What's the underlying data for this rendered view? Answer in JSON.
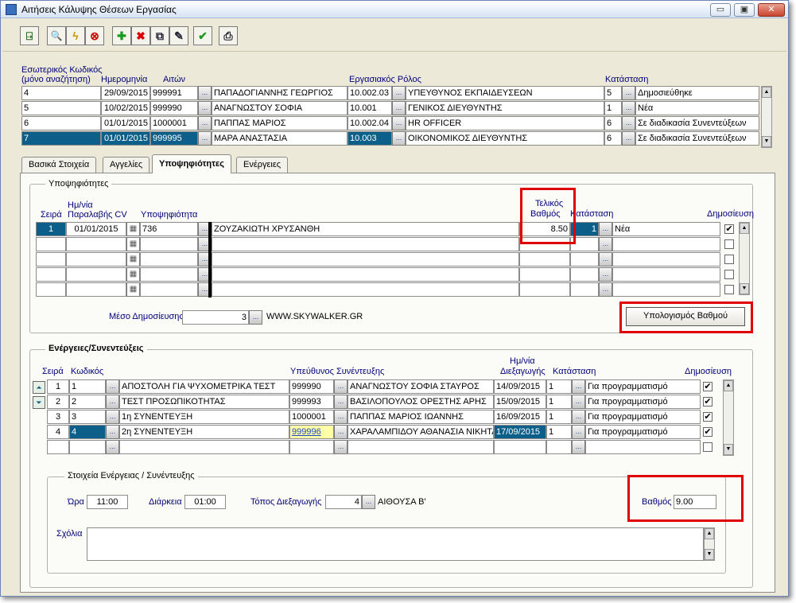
{
  "window": {
    "title": "Αιτήσεις Κάλυψης Θέσεων Εργασίας",
    "controls": {
      "minimize": "▭",
      "restore": "▣",
      "close": "✕"
    }
  },
  "toolbar": {
    "buttons": [
      {
        "name": "exit-icon",
        "glyph": "⍈"
      },
      {
        "name": "search-icon",
        "glyph": "🔍"
      },
      {
        "name": "lightning-icon",
        "glyph": "ϟ"
      },
      {
        "name": "cancel-icon",
        "glyph": "⊗"
      },
      {
        "name": "add-icon",
        "glyph": "✚"
      },
      {
        "name": "delete-icon",
        "glyph": "✖"
      },
      {
        "name": "copy-icon",
        "glyph": "⧉"
      },
      {
        "name": "edit-icon",
        "glyph": "✎"
      },
      {
        "name": "confirm-icon",
        "glyph": "✔"
      },
      {
        "name": "print-icon",
        "glyph": "⎙"
      }
    ]
  },
  "header": {
    "col_internal_code": "Εσωτερικός Κωδικός",
    "col_internal_code_sub": "(μόνο αναζήτηση)",
    "col_date": "Ημερομηνία",
    "col_applicant": "Αιτών",
    "col_role": "Εργασιακός Ρόλος",
    "col_status": "Κατάσταση"
  },
  "requests": [
    {
      "code": "4",
      "date": "29/09/2015",
      "applicant_id": "999991",
      "applicant": "ΠΑΠΑΔΟΓΙΑΝΝΗΣ ΓΕΩΡΓΙΟΣ",
      "role_code": "10.002.03",
      "role": "ΥΠΕΥΘΥΝΟΣ ΕΚΠΑΙΔΕΥΣΕΩΝ",
      "status_code": "5",
      "status": "Δημοσιεύθηκε"
    },
    {
      "code": "5",
      "date": "10/02/2015",
      "applicant_id": "999990",
      "applicant": "ΑΝΑΓΝΩΣΤΟΥ ΣΟΦΙΑ",
      "role_code": "10.001",
      "role": "ΓΕΝΙΚΟΣ ΔΙΕΥΘΥΝΤΗΣ",
      "status_code": "1",
      "status": "Νέα"
    },
    {
      "code": "6",
      "date": "01/01/2015",
      "applicant_id": "1000001",
      "applicant": "ΠΑΠΠΑΣ ΜΑΡΙΟΣ",
      "role_code": "10.002.04",
      "role": "HR OFFICER",
      "status_code": "6",
      "status": "Σε διαδικασία Συνεντεύξεων"
    },
    {
      "code": "7",
      "date": "01/01/2015",
      "applicant_id": "999995",
      "applicant": "ΜΑΡΑ ΑΝΑΣΤΑΣΙΑ",
      "role_code": "10.003",
      "role": "ΟΙΚΟΝΟΜΙΚΟΣ ΔΙΕΥΘΥΝΤΗΣ",
      "status_code": "6",
      "status": "Σε διαδικασία Συνεντεύξεων"
    }
  ],
  "tabs": [
    "Βασικά Στοιχεία",
    "Αγγελίες",
    "Υποψηφιότητες",
    "Ενέργειες"
  ],
  "candidates": {
    "group_title": "Υποψηφιότητες",
    "col_seq": "Σειρά",
    "col_date_1": "Ημ/νία",
    "col_date_2": "Παραλαβής CV",
    "col_candidate": "Υποψηφιότητα",
    "col_grade_1": "Τελικός",
    "col_grade_2": "Βαθμός",
    "col_status": "Κατάσταση",
    "col_publish": "Δημοσίευση",
    "rows": [
      {
        "seq": "1",
        "date": "01/01/2015",
        "cand_id": "736",
        "name": "ΖΟΥΖΑΚΙΩΤΗ ΧΡΥΣΑΝΘΗ",
        "grade": "8.50",
        "status_code": "1",
        "status": "Νέα",
        "publish": "✔"
      }
    ],
    "media_label": "Μέσο Δημοσίευσης",
    "media_code": "3",
    "media_name": "WWW.SKYWALKER.GR",
    "calc_button": "Υπολογισμός Βαθμού"
  },
  "actions": {
    "group_title": "Ενέργειες/Συνεντεύξεις",
    "col_seq": "Σειρά",
    "col_code": "Κωδικός",
    "col_interviewer": "Υπεύθυνος Συνέντευξης",
    "col_date_1": "Ημ/νία",
    "col_date_2": "Διεξαγωγής",
    "col_status": "Κατάσταση",
    "col_publish": "Δημοσίευση",
    "rows": [
      {
        "seq": "1",
        "code": "1",
        "name": "ΑΠΟΣΤΟΛΗ ΓΙΑ ΨΥΧΟΜΕΤΡΙΚΑ ΤΕΣΤ",
        "int_id": "999990",
        "interviewer": "ΑΝΑΓΝΩΣΤΟΥ ΣΟΦΙΑ ΣΤΑΥΡΟΣ",
        "date": "14/09/2015",
        "status_code": "1",
        "status": "Για προγραμματισμό",
        "publish": "✔"
      },
      {
        "seq": "2",
        "code": "2",
        "name": "ΤΕΣΤ ΠΡΟΣΩΠΙΚΟΤΗΤΑΣ",
        "int_id": "999993",
        "interviewer": "ΒΑΣΙΛΟΠΟΥΛΟΣ ΟΡΕΣΤΗΣ ΑΡΗΣ",
        "date": "15/09/2015",
        "status_code": "1",
        "status": "Για προγραμματισμό",
        "publish": "✔"
      },
      {
        "seq": "3",
        "code": "3",
        "name": "1η ΣΥΝΕΝΤΕΥΞΗ",
        "int_id": "1000001",
        "interviewer": "ΠΑΠΠΑΣ ΜΑΡΙΟΣ ΙΩΑΝΝΗΣ",
        "date": "16/09/2015",
        "status_code": "1",
        "status": "Για προγραμματισμό",
        "publish": "✔"
      },
      {
        "seq": "4",
        "code": "4",
        "name": "2η ΣΥΝΕΝΤΕΥΞΗ",
        "int_id": "999996",
        "interviewer": "ΧΑΡΑΛΑΜΠΙΔΟΥ ΑΘΑΝΑΣΙΑ ΝΙΚΗΤΑ",
        "date": "17/09/2015",
        "status_code": "1",
        "status": "Για προγραμματισμό",
        "publish": "✔"
      }
    ]
  },
  "details": {
    "group_title": "Στοιχεία Ενέργειας / Συνέντευξης",
    "time_label": "Ώρα",
    "time": "11:00",
    "duration_label": "Διάρκεια",
    "duration": "01:00",
    "place_label": "Τόπος Διεξαγωγής",
    "place_code": "4",
    "place_name": "ΑΙΘΟΥΣΑ Β'",
    "grade_label": "Βαθμός",
    "grade": "9.00",
    "comments_label": "Σχόλια",
    "comments": ""
  },
  "ui": {
    "lookup_glyph": "...",
    "calendar_glyph": "▦",
    "scroll_up": "▲",
    "scroll_down": "▼",
    "nav_up": "⏶",
    "nav_down": "⏷"
  },
  "colors": {
    "selection": "#0b5f88",
    "highlight": "#e00000",
    "field_yellow": "#ffffa8"
  }
}
